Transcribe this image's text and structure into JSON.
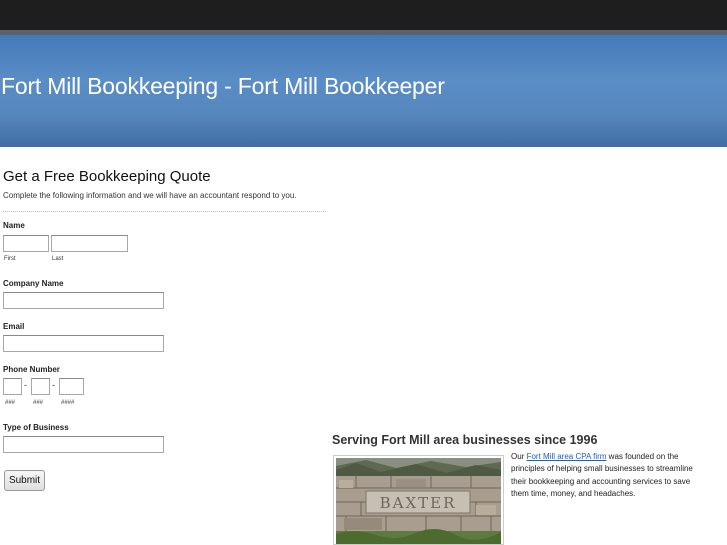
{
  "header": {
    "title": "Fort Mill Bookkeeping - Fort Mill Bookkeeper"
  },
  "form": {
    "title": "Get a Free Bookkeeping Quote",
    "description": "Complete the following information and we will have an accountant respond to you.",
    "name": {
      "label": "Name",
      "first_sub": "First",
      "last_sub": "Last",
      "first_value": "",
      "last_value": ""
    },
    "company": {
      "label": "Company Name",
      "value": ""
    },
    "email": {
      "label": "Email",
      "value": ""
    },
    "phone": {
      "label": "Phone Number",
      "sub1": "###",
      "sub2": "###",
      "sub3": "####",
      "sep": "-"
    },
    "business_type": {
      "label": "Type of Business",
      "value": ""
    },
    "submit_label": "Submit"
  },
  "serving": {
    "heading": "Serving Fort Mill area businesses since 1996",
    "text_before": "Our ",
    "link_text": "Fort Mill area CPA firm",
    "text_after": " was founded on the principles of helping small businesses to streamline their bookkeeping and accounting services to save them time, money, and headaches.",
    "photo_sign_text": "BAXTER"
  },
  "colors": {
    "banner": "#4a7fbd",
    "topbar": "#1e1e1e",
    "link": "#1a5fc4"
  }
}
